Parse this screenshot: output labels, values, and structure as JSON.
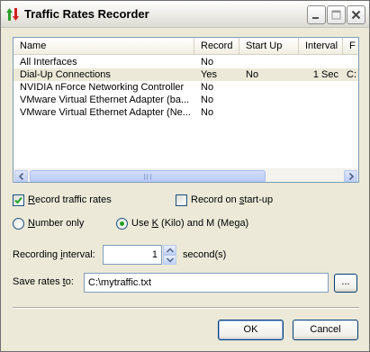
{
  "window": {
    "title": "Traffic Rates Recorder",
    "icon": "traffic-arrows-icon"
  },
  "listview": {
    "columns": [
      "Name",
      "Record",
      "Start Up",
      "Interval",
      "F"
    ],
    "rows": [
      {
        "name": "All Interfaces",
        "record": "No",
        "startup": "",
        "interval": "",
        "file": ""
      },
      {
        "name": "Dial-Up Connections",
        "record": "Yes",
        "startup": "No",
        "interval": "1 Sec",
        "file": "C:"
      },
      {
        "name": "NVIDIA nForce Networking Controller",
        "record": "No",
        "startup": "",
        "interval": "",
        "file": ""
      },
      {
        "name": "VMware Virtual Ethernet Adapter (ba...",
        "record": "No",
        "startup": "",
        "interval": "",
        "file": ""
      },
      {
        "name": "VMware Virtual Ethernet Adapter (Ne...",
        "record": "No",
        "startup": "",
        "interval": "",
        "file": ""
      }
    ],
    "selected_row": 1
  },
  "options": {
    "record_traffic": {
      "label_pre": "",
      "accel": "R",
      "label_post": "ecord traffic rates",
      "checked": true
    },
    "record_startup": {
      "label_pre": "Record on ",
      "accel": "s",
      "label_post": "tart-up",
      "checked": false
    },
    "number_only": {
      "label_pre": "",
      "accel": "N",
      "label_post": "umber only",
      "selected": false
    },
    "kilo_mega": {
      "label_pre": "Use ",
      "accel": "K",
      "label_post": " (Kilo) and M (Mega)",
      "selected": true
    }
  },
  "interval": {
    "label_pre": "Recording ",
    "accel": "i",
    "label_post": "nterval:",
    "value": "1",
    "unit": "second(s)"
  },
  "save": {
    "label_pre": "Save rates ",
    "accel": "t",
    "label_post": "o:",
    "path": "C:\\mytraffic.txt",
    "browse_label": "..."
  },
  "buttons": {
    "ok": "OK",
    "cancel": "Cancel"
  },
  "colors": {
    "check_mark": "#21a121",
    "selection": "#ece9d8",
    "accent_border": "#003c74"
  }
}
